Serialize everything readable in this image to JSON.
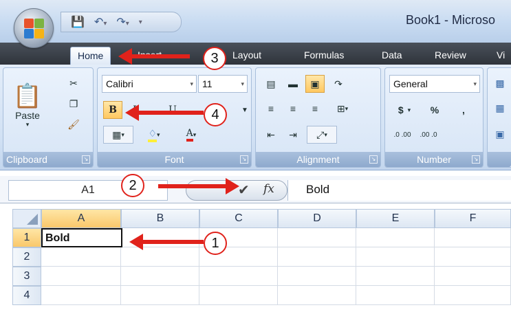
{
  "window": {
    "title": "Book1 - Microso"
  },
  "tabs": [
    {
      "label": "Home"
    },
    {
      "label": "Insert"
    },
    {
      "label": "Layout"
    },
    {
      "label": "Formulas"
    },
    {
      "label": "Data"
    },
    {
      "label": "Review"
    },
    {
      "label": "Vi"
    }
  ],
  "ribbon": {
    "clipboard": {
      "label": "Clipboard",
      "paste_label": "Paste"
    },
    "font": {
      "label": "Font",
      "font_name": "Calibri",
      "font_size": "11",
      "bold_label": "B",
      "italic_label": "I",
      "underline_label": "U",
      "font_color_label": "A"
    },
    "alignment": {
      "label": "Alignment"
    },
    "number": {
      "label": "Number",
      "format": "General",
      "currency": "$",
      "percent": "%",
      "comma": ",",
      "inc_decimal": ".0 .00",
      "dec_decimal": ".00 .0"
    }
  },
  "formula_bar": {
    "name_box": "A1",
    "fx_label": "fx",
    "content": "Bold"
  },
  "grid": {
    "columns": [
      "A",
      "B",
      "C",
      "D",
      "E",
      "F"
    ],
    "rows": [
      "1",
      "2",
      "3",
      "4"
    ],
    "cells": {
      "A1": "Bold"
    }
  },
  "annotations": [
    "1",
    "2",
    "3",
    "4"
  ],
  "colors": {
    "annotation_red": "#e0221b",
    "selection_orange": "#ffc860",
    "ribbon_blue": "#d1e1f4"
  }
}
